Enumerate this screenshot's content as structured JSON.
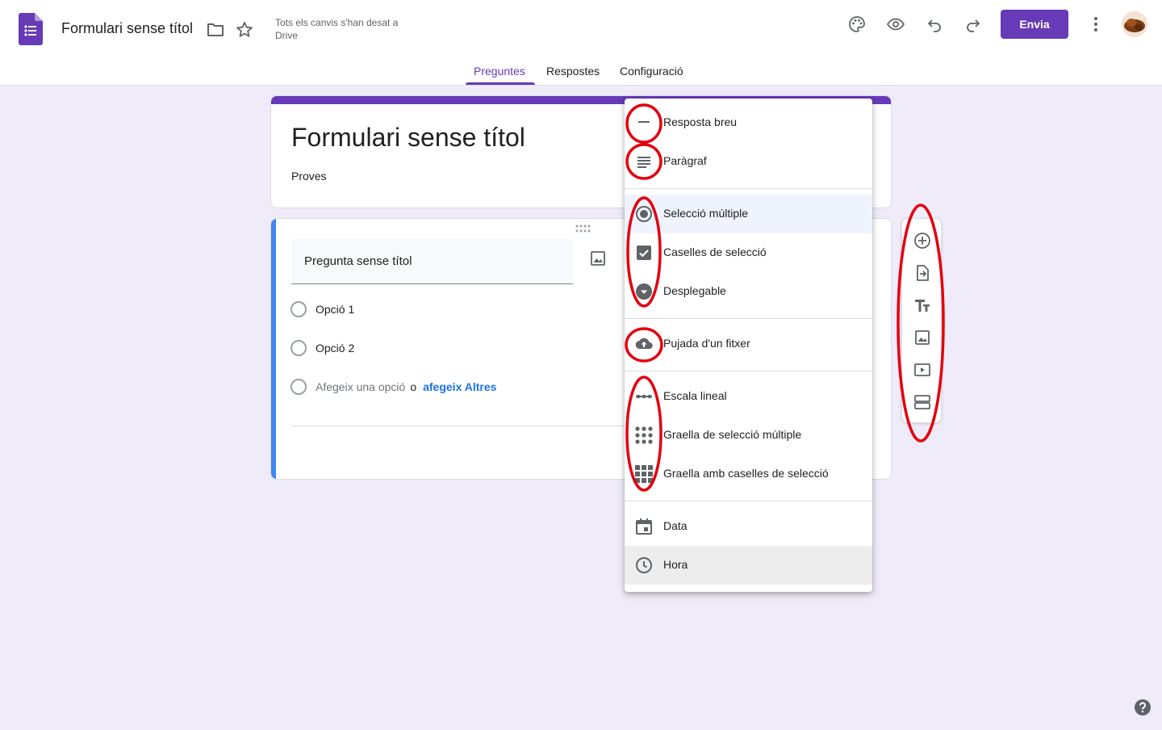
{
  "header": {
    "doc_title": "Formulari sense títol",
    "save_status": "Tots els canvis s'han desat a Drive",
    "send_label": "Envia",
    "icons": [
      "palette-icon",
      "preview-eye-icon",
      "undo-icon",
      "redo-icon",
      "more-vert-icon"
    ]
  },
  "tabs": [
    {
      "label": "Preguntes",
      "active": true
    },
    {
      "label": "Respostes",
      "active": false
    },
    {
      "label": "Configuració",
      "active": false
    }
  ],
  "form": {
    "title": "Formulari sense títol",
    "description": "Proves"
  },
  "question": {
    "title": "Pregunta sense títol",
    "options": [
      "Opció 1",
      "Opció 2"
    ],
    "add_option": "Afegeix una opció",
    "or": "o",
    "add_other": "afegeix Altres"
  },
  "menu": {
    "items": [
      {
        "label": "Resposta breu",
        "icon": "short-answer-icon"
      },
      {
        "label": "Paràgraf",
        "icon": "paragraph-icon"
      },
      {
        "label": "Selecció múltiple",
        "icon": "radio-button-icon",
        "selected": true
      },
      {
        "label": "Caselles de selecció",
        "icon": "checkbox-icon"
      },
      {
        "label": "Desplegable",
        "icon": "dropdown-icon"
      },
      {
        "label": "Pujada d'un fitxer",
        "icon": "cloud-upload-icon"
      },
      {
        "label": "Escala lineal",
        "icon": "linear-scale-icon"
      },
      {
        "label": "Graella de selecció múltiple",
        "icon": "grid-dots-icon"
      },
      {
        "label": "Graella amb caselles de selecció",
        "icon": "grid-squares-icon"
      },
      {
        "label": "Data",
        "icon": "calendar-icon"
      },
      {
        "label": "Hora",
        "icon": "clock-icon",
        "hover": true
      }
    ]
  },
  "side_toolbar": [
    "add-question-icon",
    "import-questions-icon",
    "add-title-icon",
    "add-image-icon",
    "add-video-icon",
    "add-section-icon"
  ],
  "colors": {
    "accent": "#673ab7",
    "background": "#f0ebf8",
    "annotation": "#e3000f",
    "question_accent": "#4285f4"
  }
}
